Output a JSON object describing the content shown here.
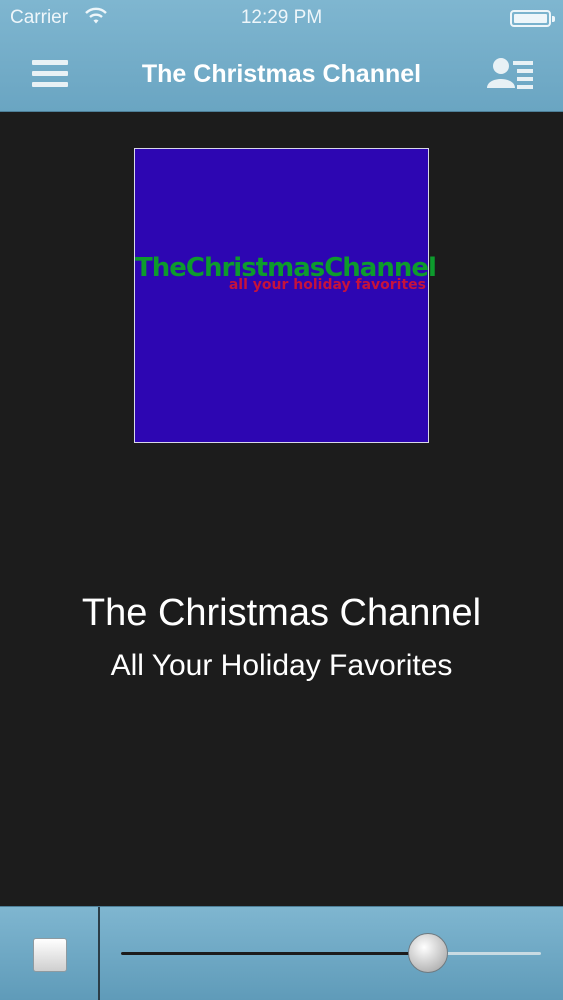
{
  "status_bar": {
    "carrier": "Carrier",
    "time": "12:29 PM"
  },
  "nav": {
    "title": "The Christmas Channel",
    "menu_icon": "hamburger-menu-icon",
    "right_icon": "contact-list-icon"
  },
  "artwork": {
    "title": "TheChristmasChannel",
    "subtitle": "all your holiday favorites",
    "background": "#2d06b2",
    "title_color": "#0d9b2d",
    "subtitle_color": "#c5123d"
  },
  "station": {
    "name": "The Christmas Channel",
    "tagline": "All Your Holiday Favorites"
  },
  "player": {
    "stop_icon": "stop-icon",
    "volume": 0.73
  },
  "colors": {
    "bar": "#6aa5c2",
    "background": "#1c1c1c"
  }
}
